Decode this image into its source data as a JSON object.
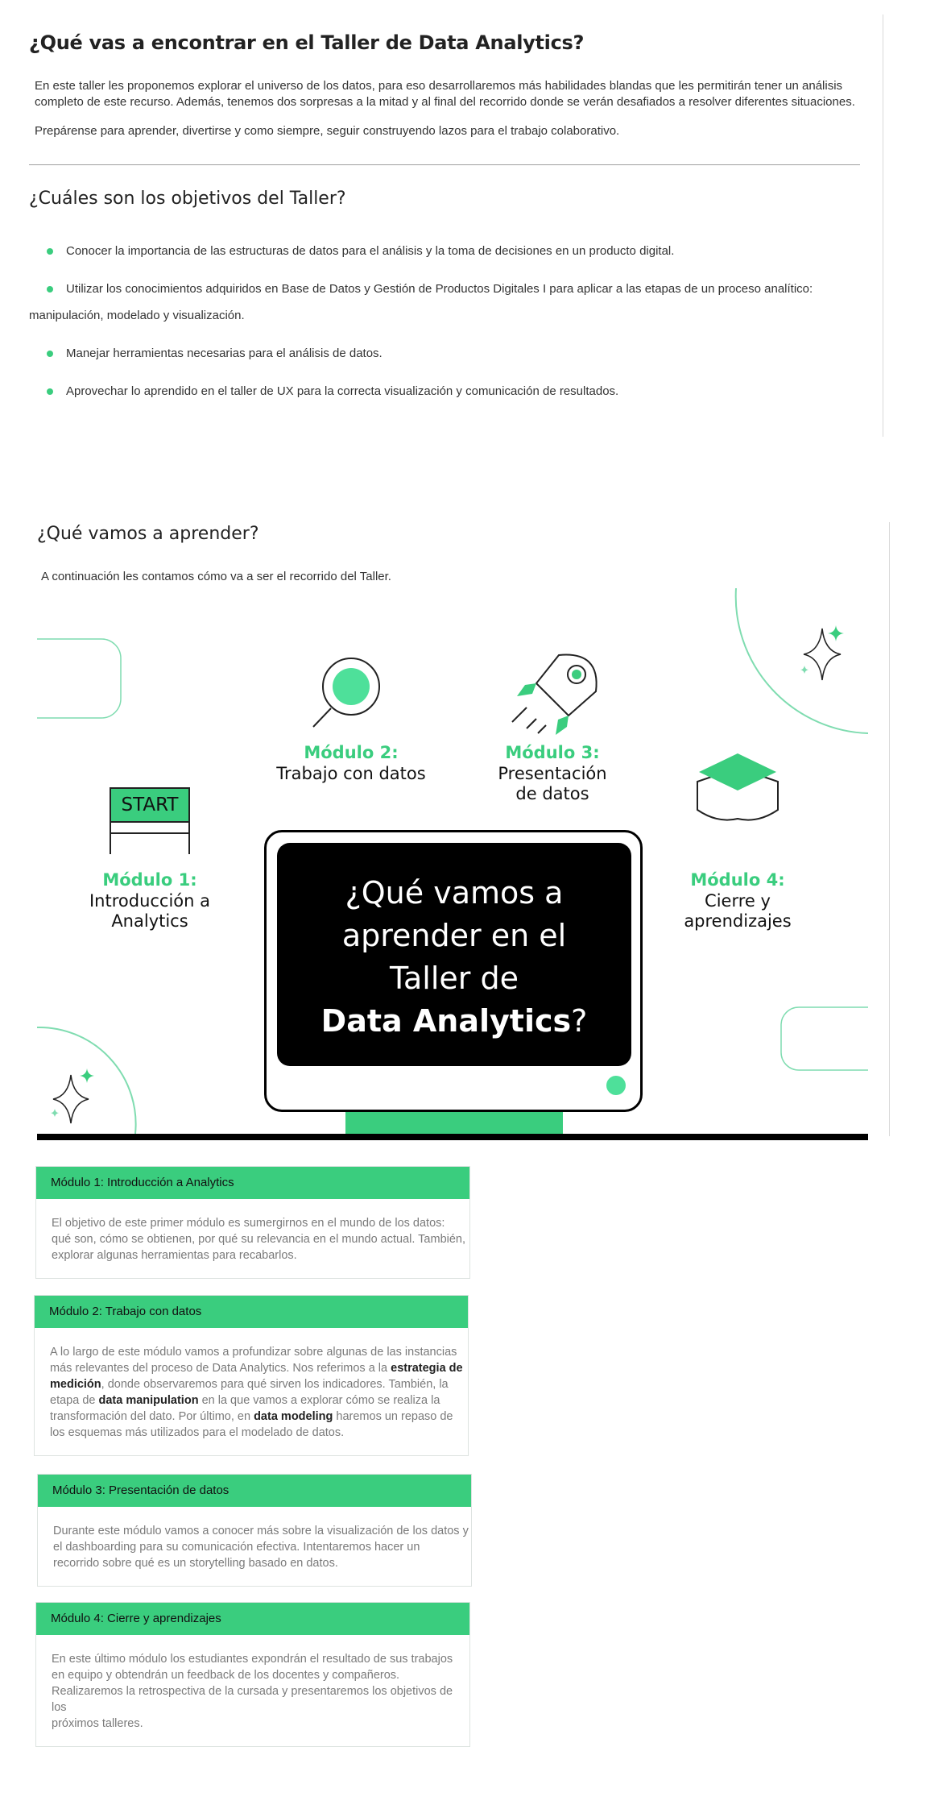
{
  "intro": {
    "title": "¿Qué vas a encontrar en el Taller de Data Analytics?",
    "p1_l1": "En este taller les proponemos explorar el universo de los datos, para eso desarrollaremos más habilidades blandas que les permitirán tener un análisis",
    "p1_l2": "completo de este recurso. Además, tenemos dos sorpresas a la mitad y al final del recorrido donde se verán desafiados a resolver diferentes situaciones.",
    "p2": "Prepárense para aprender, divertirse y como siempre, seguir construyendo lazos para el trabajo colaborativo."
  },
  "objectives": {
    "title": "¿Cuáles son los objetivos del Taller?",
    "items": [
      "Conocer la importancia de las estructuras de datos para el análisis y la toma de decisiones en un producto digital.",
      "Utilizar los conocimientos adquiridos en Base de Datos y Gestión de Productos Digitales I para aplicar a las etapas de un proceso analítico:",
      "Manejar herramientas necesarias para el análisis de datos.",
      "Aprovechar lo aprendido en el taller de UX para la correcta visualización y comunicación de resultados."
    ],
    "item2_cont": "manipulación, modelado y visualización."
  },
  "learn": {
    "title": "¿Qué vamos a aprender?",
    "subtitle": "A continuación les contamos cómo va a ser el recorrido del Taller."
  },
  "infographic": {
    "start_label": "START",
    "m1_title": "Módulo 1:",
    "m1_l1": "Introducción a",
    "m1_l2": "Analytics",
    "m2_title": "Módulo 2:",
    "m2_l1": "Trabajo con datos",
    "m3_title": "Módulo 3:",
    "m3_l1": "Presentación",
    "m3_l2": "de datos",
    "m4_title": "Módulo 4:",
    "m4_l1": "Cierre y",
    "m4_l2": "aprendizajes",
    "screen_l1": "¿Qué vamos a",
    "screen_l2": "aprender en el",
    "screen_l3": "Taller de",
    "screen_hl": "Data Analytics",
    "screen_q": "?",
    "accent": "#3acd7e"
  },
  "cards": {
    "c1": {
      "title": "Módulo 1: Introducción a Analytics",
      "l1": "El objetivo de este primer módulo es sumergirnos en el mundo de los datos:",
      "l2": "qué son, cómo se obtienen, por qué su relevancia en el mundo actual. También,",
      "l3": "explorar algunas herramientas para recabarlos."
    },
    "c2": {
      "title": "Módulo 2: Trabajo con datos",
      "l1": "A lo largo de este módulo vamos a profundizar sobre algunas de las instancias",
      "l2a": "más relevantes del proceso de Data Analytics. Nos referimos a la ",
      "l2b": "estrategia de",
      "l3a": "medición",
      "l3b": ", donde observaremos para qué sirven los indicadores. También, la",
      "l4a": "etapa de ",
      "l4b": "data manipulation",
      "l4c": " en la que vamos a explorar cómo se realiza la",
      "l5a": "transformación del dato. Por último, en ",
      "l5b": "data modeling",
      "l5c": " haremos un repaso de",
      "l6": "los esquemas más utilizados para el modelado de datos."
    },
    "c3": {
      "title": "Módulo 3: Presentación de datos",
      "l1": "Durante este módulo vamos a conocer más sobre la visualización de los datos y",
      "l2": "el dashboarding para su comunicación efectiva. Intentaremos hacer un",
      "l3": "recorrido sobre qué es un storytelling basado en datos."
    },
    "c4": {
      "title": "Módulo 4: Cierre y aprendizajes",
      "l1": "En este último módulo los estudiantes expondrán el resultado de sus trabajos",
      "l2": "en equipo y obtendrán un feedback de los docentes y compañeros.",
      "l3": "Realizaremos la retrospectiva de la cursada y presentaremos los objetivos de los",
      "l4": "próximos talleres."
    }
  }
}
